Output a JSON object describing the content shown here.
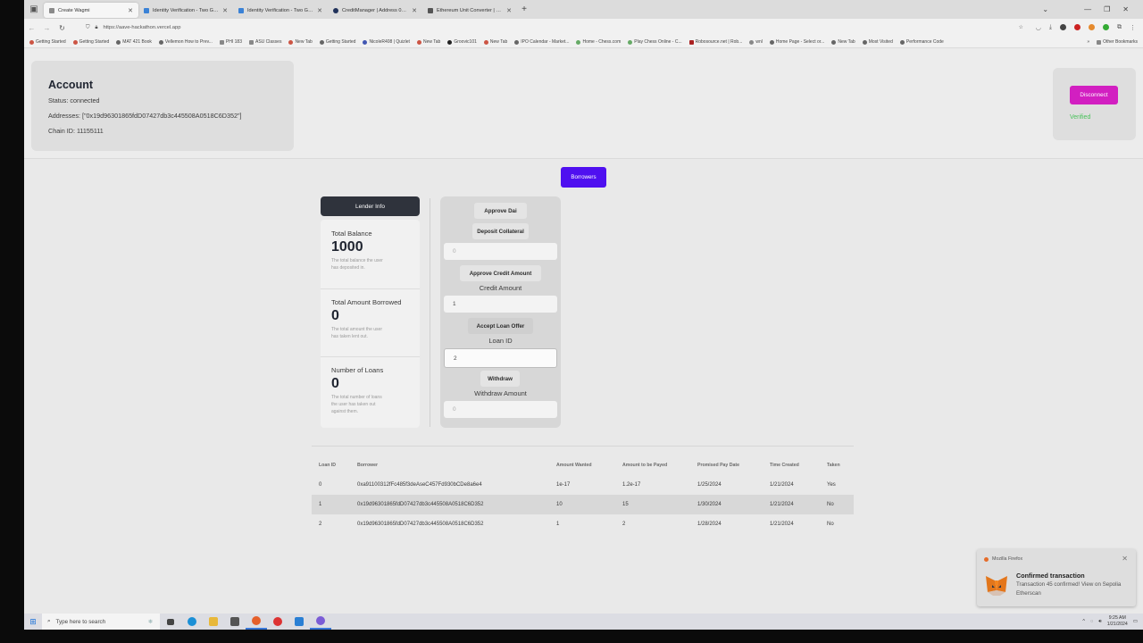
{
  "browser": {
    "tabs": [
      {
        "title": "Create Wagmi",
        "active": true
      },
      {
        "title": "Identity Verification - Two Guys"
      },
      {
        "title": "Identity Verification - Two Guys"
      },
      {
        "title": "CreditManager | Address 0x5e..."
      },
      {
        "title": "Ethereum Unit Converter | Ethe..."
      }
    ],
    "url": "https://aave-hackathon.vercel.app",
    "bookmarks": [
      "Getting Started",
      "Getting Started",
      "MAT 421 Book",
      "Vellemon How to Prev...",
      "PHI 183",
      "ASU Classes",
      "New Tab",
      "Getting Started",
      "NicoleR408 | Quizlet",
      "New Tab",
      "Groovic101",
      "New Tab",
      "IPO Calendar - Market...",
      "Home - Chess.com",
      "Play Chess Online - C...",
      "Robosource.net | Rob...",
      "wnl",
      "Home Page - Select or...",
      "New Tab",
      "Most Visited",
      "Performance Code"
    ],
    "other_bookmarks": "Other Bookmarks"
  },
  "account": {
    "title": "Account",
    "status": "Status: connected",
    "addresses": "Addresses: [\"0x19d96301865fdD07427db3c445508A0518C6D352\"]",
    "chain": "Chain ID: 11155111"
  },
  "disconnect": {
    "label": "Disconnect",
    "verified": "Verified"
  },
  "borrowers_button": "Borrowers",
  "lender": {
    "header": "Lender Info",
    "stats": [
      {
        "label": "Total Balance",
        "value": "1000",
        "desc": "The total balance the user has deposited in."
      },
      {
        "label": "Total Amount Borrowed",
        "value": "0",
        "desc": "The total amount the user has taken lent out."
      },
      {
        "label": "Number of Loans",
        "value": "0",
        "desc": "The total number of loans the user has taken out against them."
      }
    ]
  },
  "actions": {
    "approve_dai": "Approve Dai",
    "deposit_collateral": "Deposit Collateral",
    "collateral_placeholder": "0",
    "approve_credit": "Approve Credit Amount",
    "credit_label": "Credit Amount",
    "credit_value": "1",
    "accept_loan": "Accept Loan Offer",
    "loan_id_label": "Loan ID",
    "loan_id_value": "2",
    "withdraw": "Withdraw",
    "withdraw_label": "Withdraw Amount",
    "withdraw_placeholder": "0"
  },
  "loans_table": {
    "headers": [
      "Loan ID",
      "Borrower",
      "Amount Wanted",
      "Amount to be Payed",
      "Promised Pay Date",
      "Time Created",
      "Taken"
    ],
    "rows": [
      [
        "0",
        "0xa91100312fFc485f3deAseC457Fd930bCDe8a6e4",
        "1e-17",
        "1.2e-17",
        "1/25/2024",
        "1/21/2024",
        "Yes"
      ],
      [
        "1",
        "0x19d96301865fdD07427db3c445508A0518C6D352",
        "10",
        "15",
        "1/30/2024",
        "1/21/2024",
        "No"
      ],
      [
        "2",
        "0x19d96301865fdD07427db3c445508A0518C6D352",
        "1",
        "2",
        "1/28/2024",
        "1/21/2024",
        "No"
      ]
    ],
    "highlight_row": 1
  },
  "toast": {
    "app": "Mozilla Firefox",
    "title": "Confirmed transaction",
    "body": "Transaction 45 confirmed! View on Sepolia Etherscan"
  },
  "taskbar": {
    "search_placeholder": "Type here to search",
    "time": "9:25 AM",
    "date": "1/21/2024"
  },
  "colors": {
    "disconnect": "#d21fc1",
    "borrowers": "#4f10f0",
    "lender_header": "#2f333c",
    "verified": "#48c25a"
  }
}
